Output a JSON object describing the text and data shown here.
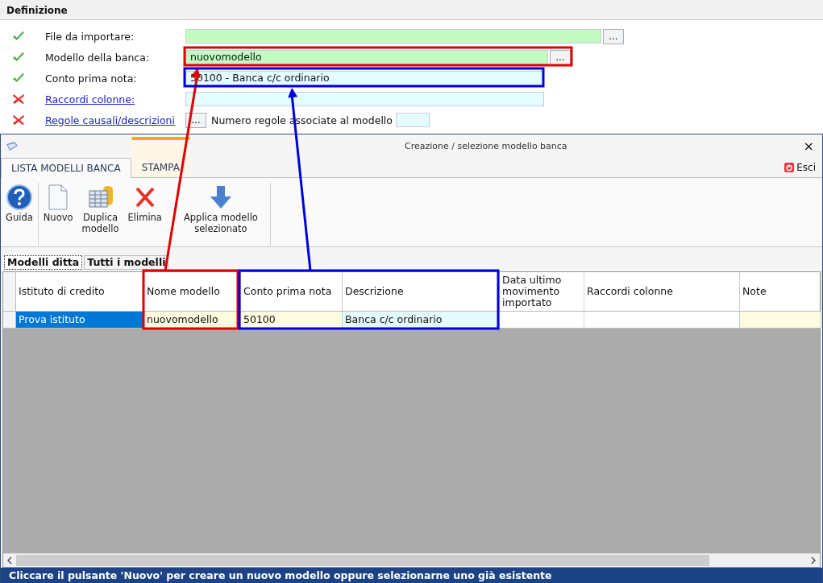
{
  "definition": {
    "title": "Definizione",
    "rows": [
      {
        "kind": "field",
        "valid": true,
        "label": "File da importare:",
        "value": "",
        "browse": "...",
        "color": "#c3fbc3"
      },
      {
        "kind": "field",
        "valid": true,
        "label": "Modello della banca:",
        "value": "nuovomodello",
        "browse": "...",
        "color": "#c3fbc3"
      },
      {
        "kind": "field",
        "valid": true,
        "label": "Conto prima nota:",
        "value": "50100 - Banca c/c ordinario",
        "color": "#e4fdff"
      },
      {
        "kind": "link",
        "valid": false,
        "label": "Raccordi colonne:",
        "value": "",
        "color": "#e4fdff"
      },
      {
        "kind": "rules",
        "valid": false,
        "label": "Regole causali/descrizioni",
        "browse": "...",
        "count_label": "Numero regole associate al modello",
        "value": ""
      }
    ]
  },
  "dialog": {
    "title": "Creazione / selezione modello banca",
    "close": "×",
    "exit": "Esci",
    "tabs": [
      {
        "label": "LISTA MODELLI BANCA",
        "selected": true
      },
      {
        "label": "STAMPA",
        "selected": false
      }
    ],
    "toolbar": [
      {
        "kind": "help",
        "label": "Guida"
      },
      {
        "kind": "new",
        "label": "Nuovo"
      },
      {
        "kind": "duplicate",
        "label": "Duplica modello"
      },
      {
        "kind": "delete",
        "label": "Elimina"
      },
      {
        "kind": "apply",
        "label": "Applica modello selezionato"
      }
    ],
    "subtabs": [
      {
        "label": "Modelli ditta",
        "selected": true
      },
      {
        "label": "Tutti i modelli",
        "selected": false
      }
    ],
    "table": {
      "columns": [
        "Istituto di credito",
        "Nome modello",
        "Conto prima nota",
        "Descrizione",
        "Data ultimo movimento importato",
        "Raccordi colonne",
        "Note"
      ],
      "rows": [
        {
          "selected": true,
          "cells": [
            "Prova istituto",
            "nuovomodello",
            "50100",
            "Banca c/c ordinario",
            "",
            "",
            ""
          ]
        }
      ]
    },
    "status": "Cliccare il pulsante 'Nuovo' per creare un nuovo modello oppure selezionarne uno già esistente"
  },
  "annotations": [
    {
      "color": "#e00000"
    },
    {
      "color": "#0000dd"
    }
  ]
}
